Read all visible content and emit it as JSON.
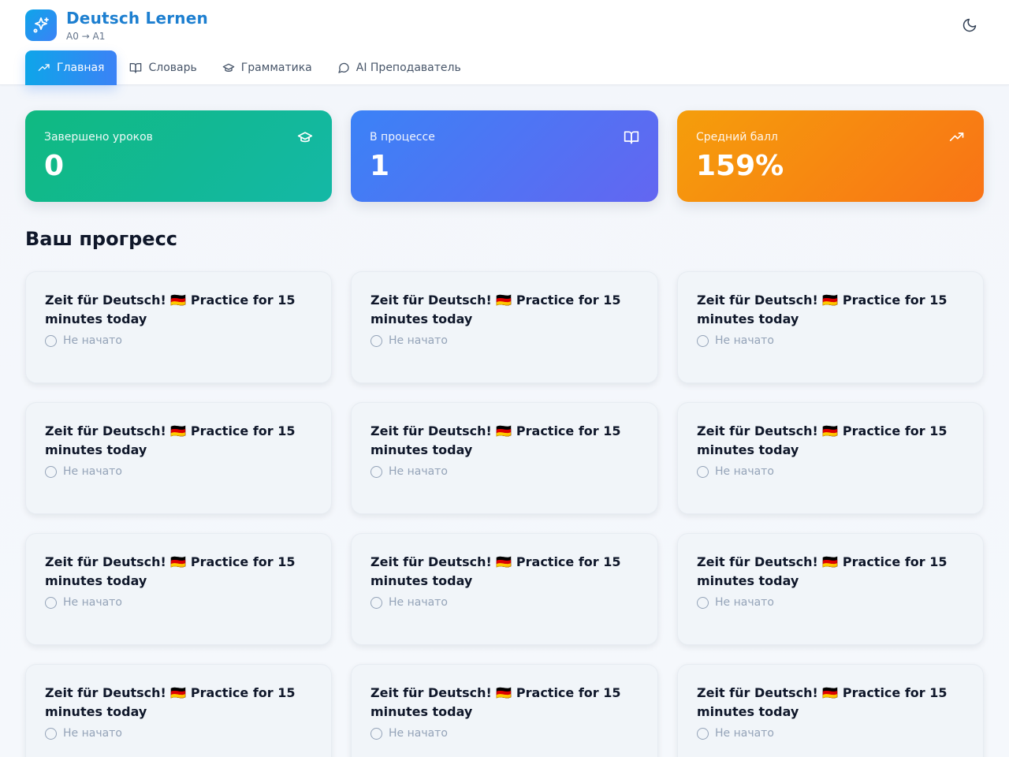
{
  "app": {
    "title": "Deutsch Lernen",
    "subtitle": "A0 → A1",
    "logo_icon": "sparkles-icon",
    "theme_icon": "moon-icon"
  },
  "nav": {
    "tabs": [
      {
        "label": "Главная",
        "icon": "trending-up-icon",
        "active": true
      },
      {
        "label": "Словарь",
        "icon": "book-open-icon",
        "active": false
      },
      {
        "label": "Грамматика",
        "icon": "graduation-cap-icon",
        "active": false
      },
      {
        "label": "AI Преподаватель",
        "icon": "message-circle-icon",
        "active": false
      }
    ]
  },
  "stats": [
    {
      "label": "Завершено уроков",
      "value": "0",
      "icon": "graduation-cap-icon",
      "color": "#10b981"
    },
    {
      "label": "В процессе",
      "value": "1",
      "icon": "book-open-icon",
      "color": "#3b82f6"
    },
    {
      "label": "Средний балл",
      "value": "159%",
      "icon": "trending-up-icon",
      "color": "#f97316"
    }
  ],
  "progress": {
    "title": "Ваш прогресс",
    "lessons": [
      {
        "title": "Zeit für Deutsch! 🇩🇪 Practice for 15 minutes today",
        "status": "Не начато"
      },
      {
        "title": "Zeit für Deutsch! 🇩🇪 Practice for 15 minutes today",
        "status": "Не начато"
      },
      {
        "title": "Zeit für Deutsch! 🇩🇪 Practice for 15 minutes today",
        "status": "Не начато"
      },
      {
        "title": "Zeit für Deutsch! 🇩🇪 Practice for 15 minutes today",
        "status": "Не начато"
      },
      {
        "title": "Zeit für Deutsch! 🇩🇪 Practice for 15 minutes today",
        "status": "Не начато"
      },
      {
        "title": "Zeit für Deutsch! 🇩🇪 Practice for 15 minutes today",
        "status": "Не начато"
      },
      {
        "title": "Zeit für Deutsch! 🇩🇪 Practice for 15 minutes today",
        "status": "Не начато"
      },
      {
        "title": "Zeit für Deutsch! 🇩🇪 Practice for 15 minutes today",
        "status": "Не начато"
      },
      {
        "title": "Zeit für Deutsch! 🇩🇪 Practice for 15 minutes today",
        "status": "Не начато"
      },
      {
        "title": "Zeit für Deutsch! 🇩🇪 Practice for 15 minutes today",
        "status": "Не начато"
      },
      {
        "title": "Zeit für Deutsch! 🇩🇪 Practice for 15 minutes today",
        "status": "Не начато"
      },
      {
        "title": "Zeit für Deutsch! 🇩🇪 Practice for 15 minutes today",
        "status": "Не начато"
      }
    ]
  }
}
